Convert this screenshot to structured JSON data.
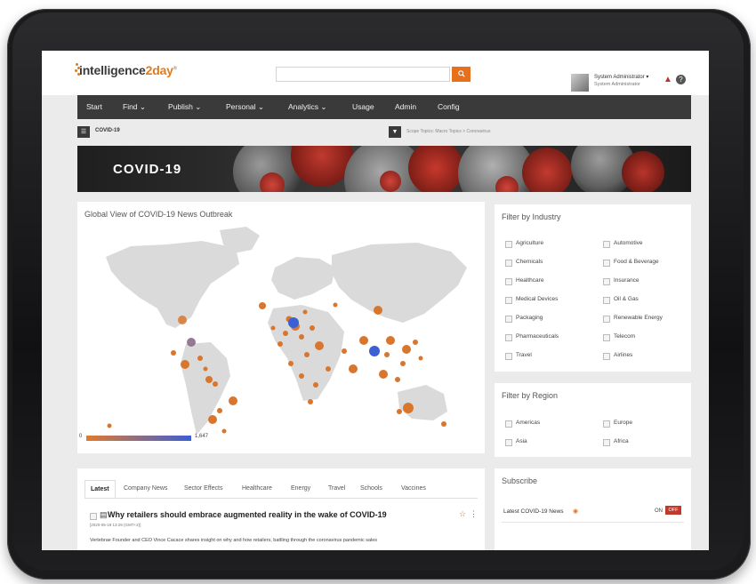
{
  "app": {
    "logo_text": "intelligence",
    "logo_accent": "2day",
    "logo_tm": "®",
    "accent_color": "#e8701d"
  },
  "search": {
    "placeholder": "",
    "button_icon": "search-icon"
  },
  "user": {
    "name": "System Administrator ▾",
    "role": "System Administrator"
  },
  "nav": {
    "items": [
      {
        "label": "Start"
      },
      {
        "label": "Find ⌄"
      },
      {
        "label": "Publish ⌄"
      },
      {
        "label": "Personal ⌄"
      },
      {
        "label": "Analytics ⌄"
      },
      {
        "label": "Usage"
      },
      {
        "label": "Admin"
      },
      {
        "label": "Config"
      }
    ]
  },
  "breadcrumb": {
    "label": "COVID-19",
    "filter_text": "Scope Topics: Macro Topics > Coronavirus"
  },
  "banner": {
    "title": "COVID-19"
  },
  "map": {
    "title": "Global View of COVID-19 News Outbreak",
    "legend_min": "0",
    "legend_max": "1,647",
    "legend_colors": [
      "#e07a2e",
      "#3b5fd4"
    ]
  },
  "industry": {
    "title": "Filter by Industry",
    "items": [
      "Agriculture",
      "Automotive",
      "Chemicals",
      "Food & Beverage",
      "Healthcare",
      "Insurance",
      "Medical Devices",
      "Oil & Gas",
      "Packaging",
      "Renewable Energy",
      "Pharmaceuticals",
      "Telecom",
      "Travel",
      "Airlines"
    ]
  },
  "region": {
    "title": "Filter by Region",
    "items": [
      "Americas",
      "Europe",
      "Asia",
      "Africa"
    ]
  },
  "news": {
    "tabs": [
      "Latest",
      "Company News",
      "Sector Effects",
      "Healthcare",
      "Energy",
      "Travel",
      "Schools",
      "Vaccines"
    ],
    "headline": "Why retailers should embrace augmented reality in the wake of COVID-19",
    "date": "[2020-05-18 13:29 (GMT+2)]",
    "snippet": "Vertebrae Founder and CEO Vince Cacace shares insight on why and how retailers, battling through the coronavirus pandemic sales"
  },
  "subscribe": {
    "title": "Subscribe",
    "item_label": "Latest COVID-19 News",
    "on_label": "ON",
    "off_label": "OFF"
  }
}
